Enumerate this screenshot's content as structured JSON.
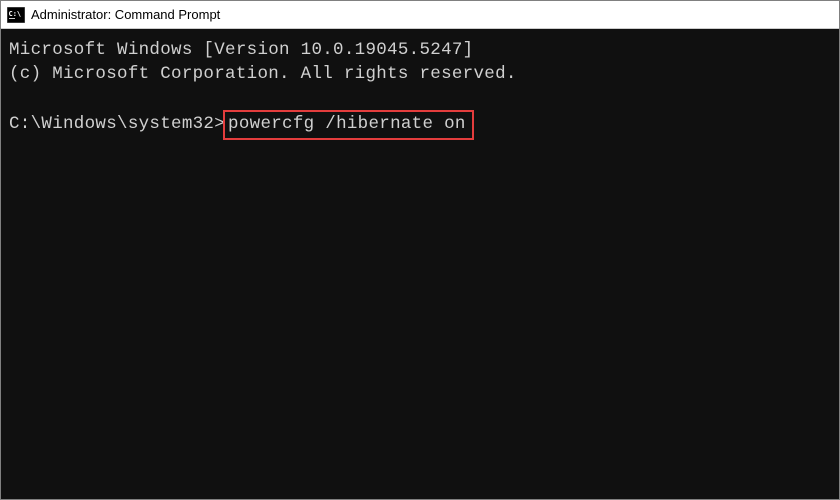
{
  "titlebar": {
    "title": "Administrator: Command Prompt"
  },
  "terminal": {
    "line1": "Microsoft Windows [Version 10.0.19045.5247]",
    "line2": "(c) Microsoft Corporation. All rights reserved.",
    "prompt": "C:\\Windows\\system32>",
    "command": "powercfg /hibernate on"
  }
}
